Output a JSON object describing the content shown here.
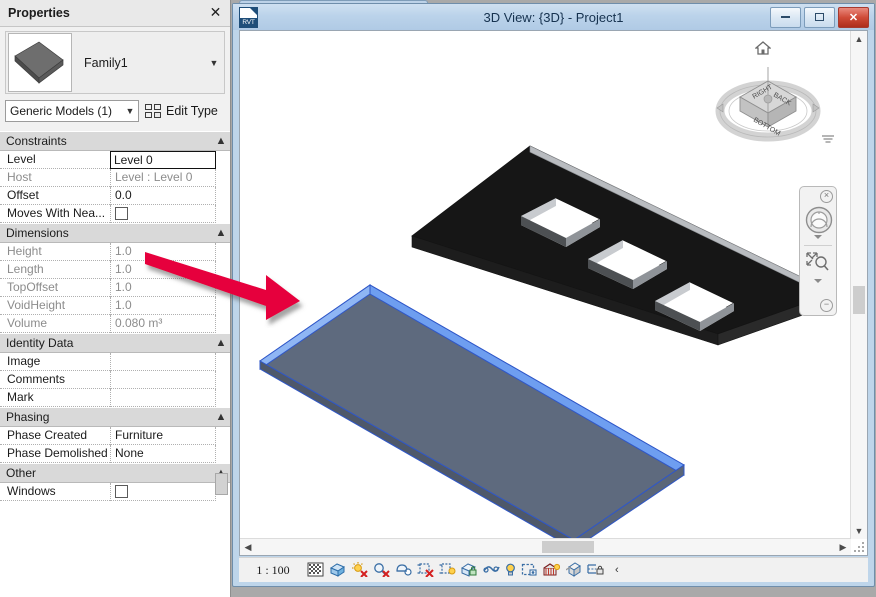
{
  "properties": {
    "title": "Properties",
    "close_icon": "close-icon",
    "family": {
      "name": "Family1",
      "dropdown_icon": "chevron-down-icon",
      "thumbnail_icon": "slab-thumbnail"
    },
    "type_selector": {
      "value": "Generic Models (1)",
      "dropdown_icon": "chevron-down-icon"
    },
    "edit_type_label": "Edit Type",
    "edit_type_icon": "edit-type-icon",
    "groups": [
      {
        "name": "Constraints",
        "collapse_icon": "chevron-up-icon",
        "rows": [
          {
            "key": "Level",
            "value": "Level 0",
            "style": "editing"
          },
          {
            "key": "Host",
            "value": "Level : Level 0",
            "style": "readonly"
          },
          {
            "key": "Offset",
            "value": "0.0",
            "style": "normal"
          },
          {
            "key": "Moves With Nea...",
            "value": "",
            "style": "checkbox"
          }
        ]
      },
      {
        "name": "Dimensions",
        "collapse_icon": "chevron-up-icon",
        "rows": [
          {
            "key": "Height",
            "value": "1.0",
            "style": "readonly"
          },
          {
            "key": "Length",
            "value": "1.0",
            "style": "readonly"
          },
          {
            "key": "TopOffset",
            "value": "1.0",
            "style": "readonly"
          },
          {
            "key": "VoidHeight",
            "value": "1.0",
            "style": "readonly"
          },
          {
            "key": "Volume",
            "value": "0.080 m³",
            "style": "readonly"
          }
        ]
      },
      {
        "name": "Identity Data",
        "collapse_icon": "chevron-up-icon",
        "rows": [
          {
            "key": "Image",
            "value": "",
            "style": "normal"
          },
          {
            "key": "Comments",
            "value": "",
            "style": "normal"
          },
          {
            "key": "Mark",
            "value": "",
            "style": "normal"
          }
        ]
      },
      {
        "name": "Phasing",
        "collapse_icon": "chevron-up-icon",
        "rows": [
          {
            "key": "Phase Created",
            "value": "Furniture",
            "style": "normal"
          },
          {
            "key": "Phase Demolished",
            "value": "None",
            "style": "normal"
          }
        ]
      },
      {
        "name": "Other",
        "collapse_icon": "chevron-up-icon",
        "rows": [
          {
            "key": "Windows",
            "value": "",
            "style": "checkbox"
          }
        ]
      }
    ]
  },
  "view_window": {
    "title": "3D View: {3D} - Project1",
    "app_icon": "rvt-file-icon",
    "app_icon_text": "RVT",
    "minimize_icon": "minimize-icon",
    "restore_icon": "restore-icon",
    "close_icon": "close-icon",
    "close_label": "✕"
  },
  "viewcube": {
    "home_icon": "home-icon",
    "faces": [
      "RIGHT",
      "BACK",
      "BOTTOM"
    ]
  },
  "navigation_bar": {
    "steering_wheel_icon": "steering-wheel-icon",
    "zoom_icon": "zoom-extents-icon",
    "close_icon": "close-icon",
    "menu_icon": "menu-icon"
  },
  "status_bar": {
    "scale": "1 : 100",
    "view_controls": [
      "detail-level-icon",
      "visual-style-icon",
      "sun-path-off-icon",
      "shadows-off-icon",
      "render-dialog-icon",
      "crop-view-off-icon",
      "crop-region-visible-icon",
      "lock-3d-view-icon",
      "temporary-hide-isolate-icon",
      "reveal-hidden-elements-icon",
      "temporary-view-properties-icon",
      "show-analytical-model-icon",
      "highlight-displacement-sets-icon",
      "worksharing-display-icon"
    ],
    "overflow_icon": "chevron-left-icon"
  },
  "scene": {
    "selected_element": {
      "name": "slab-selected",
      "fill_color": "#5e6a7e",
      "edge_color": "#2f57c8",
      "highlight_color": "#6e9ef0"
    },
    "host_element": {
      "name": "slab-host",
      "fill_color": "#161616",
      "edge_color": "#b9bcc0",
      "openings": 3
    },
    "annotation_arrow": {
      "name": "annotation-arrow",
      "color": "#e6003c"
    }
  }
}
